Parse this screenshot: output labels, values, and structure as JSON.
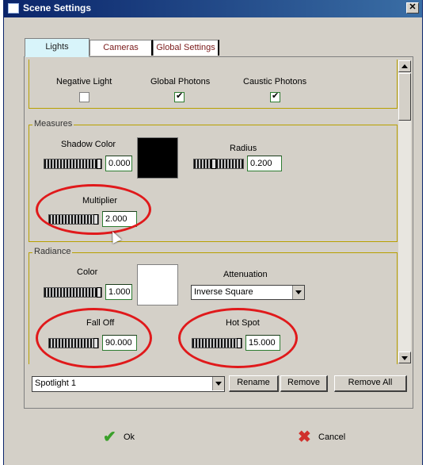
{
  "window": {
    "title": "Scene Settings",
    "close_glyph": "✕"
  },
  "tabs": [
    {
      "label": "Lights",
      "active": true
    },
    {
      "label": "Cameras",
      "active": false
    },
    {
      "label": "Global Settings",
      "active": false
    }
  ],
  "photons": {
    "negative_light": {
      "label": "Negative Light",
      "checked": false
    },
    "global_photons": {
      "label": "Global Photons",
      "checked": true
    },
    "caustic_photons": {
      "label": "Caustic Photons",
      "checked": true
    }
  },
  "measures": {
    "title": "Measures",
    "shadow_color": {
      "label": "Shadow Color",
      "value": "0.000",
      "swatch": "#000000"
    },
    "radius": {
      "label": "Radius",
      "value": "0.200"
    },
    "multiplier": {
      "label": "Multiplier",
      "value": "2.000"
    }
  },
  "radiance": {
    "title": "Radiance",
    "color": {
      "label": "Color",
      "value": "1.000",
      "swatch": "#ffffff"
    },
    "attenuation": {
      "label": "Attenuation",
      "selected": "Inverse Square"
    },
    "fall_off": {
      "label": "Fall Off",
      "value": "90.000"
    },
    "hot_spot": {
      "label": "Hot Spot",
      "value": "15.000"
    }
  },
  "light_selector": {
    "selected": "Spotlight 1"
  },
  "buttons": {
    "rename": "Rename",
    "remove": "Remove",
    "remove_all": "Remove All",
    "ok": "Ok",
    "cancel": "Cancel"
  },
  "colors": {
    "highlight": "#e0191b",
    "titlebar": "#0a246a",
    "dialog_bg": "#d4d0c8",
    "group_border": "#b8a000"
  },
  "icons": {
    "ok": "checkmark-icon",
    "cancel": "x-icon"
  }
}
